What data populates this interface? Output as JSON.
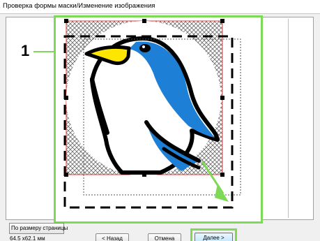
{
  "window": {
    "title": "Проверка формы маски/Изменение изображения"
  },
  "callout": {
    "number": "1"
  },
  "buttons": {
    "fit_page": "По размеру страницы",
    "back": "< Назад",
    "cancel": "Отмена",
    "next": "Далее >"
  },
  "status": {
    "size": "64.5 x62.1 мм"
  },
  "colors": {
    "highlight": "#7ed957",
    "mask_border": "#e23b3b",
    "penguin_blue": "#1e7fd6",
    "penguin_beak": "#ffe600"
  },
  "icons": {
    "canvas_image": "penguin-image",
    "resize_arrow": "diagonal-arrow-icon"
  }
}
